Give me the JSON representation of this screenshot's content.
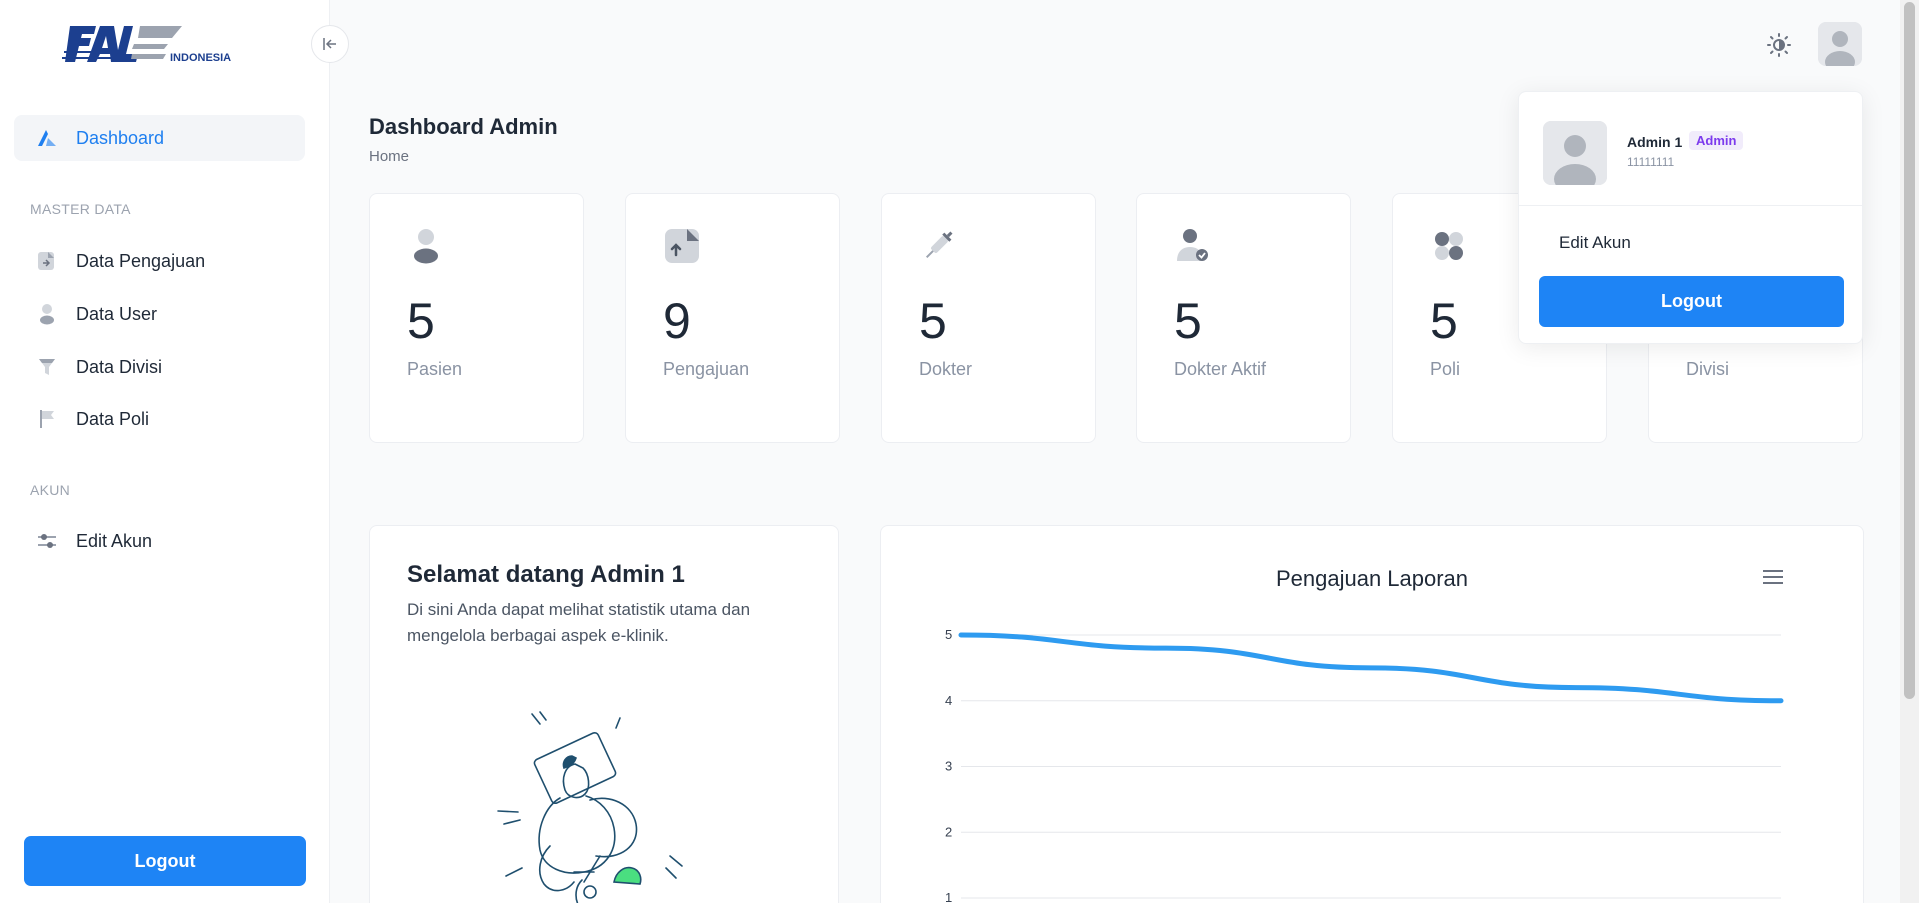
{
  "brand": {
    "logo_text": "PAL",
    "logo_sub": "INDONESIA"
  },
  "sidebar": {
    "collapse_icon": "collapse-left-icon",
    "items": [
      {
        "label": "Dashboard",
        "icon": "dashboard-icon",
        "active": true
      },
      {
        "label": "Data Pengajuan",
        "icon": "file-upload-icon"
      },
      {
        "label": "Data User",
        "icon": "user-icon"
      },
      {
        "label": "Data Divisi",
        "icon": "filter-icon"
      },
      {
        "label": "Data Poli",
        "icon": "flag-icon"
      },
      {
        "label": "Edit Akun",
        "icon": "sliders-icon"
      }
    ],
    "sections": {
      "master": "MASTER DATA",
      "akun": "AKUN"
    },
    "logout_label": "Logout"
  },
  "header": {
    "theme_icon": "sun-icon"
  },
  "page": {
    "title": "Dashboard Admin",
    "breadcrumb": "Home"
  },
  "stats": [
    {
      "value": "5",
      "label": "Pasien",
      "icon": "person-icon"
    },
    {
      "value": "9",
      "label": "Pengajuan",
      "icon": "document-upload-icon"
    },
    {
      "value": "5",
      "label": "Dokter",
      "icon": "syringe-icon"
    },
    {
      "value": "5",
      "label": "Dokter Aktif",
      "icon": "user-check-icon"
    },
    {
      "value": "5",
      "label": "Poli",
      "icon": "poli-icon"
    },
    {
      "value": "",
      "label": "Divisi",
      "icon": "divisi-icon"
    }
  ],
  "welcome": {
    "title": "Selamat datang Admin 1",
    "text": "Di sini Anda dapat melihat statistik utama dan mengelola berbagai aspek e-klinik."
  },
  "chart_data": {
    "type": "line",
    "title": "Pengajuan Laporan",
    "y_ticks": [
      "5",
      "4",
      "3",
      "2",
      "1"
    ],
    "series": [
      {
        "values": [
          5,
          4.8,
          4.5,
          4.2,
          4
        ]
      }
    ],
    "ylim": [
      1,
      5
    ],
    "grid": true,
    "color": "#2e9bf0"
  },
  "dropdown": {
    "name": "Admin 1",
    "role": "Admin",
    "user_id": "11111111",
    "edit_label": "Edit Akun",
    "logout_label": "Logout"
  },
  "colors": {
    "primary": "#1e84f5",
    "active_text": "#1e7ff0",
    "badge": "#7c3aed"
  }
}
